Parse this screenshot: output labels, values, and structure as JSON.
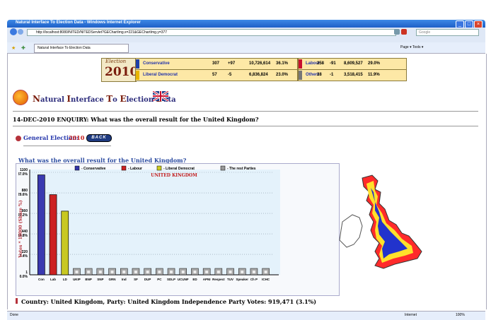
{
  "browser": {
    "window_title": "Natural Interface To Election Data - Windows Internet Explorer",
    "address": "http://localhost:8080/NITED/NITEDServlet?GEChartImg.x=221&GEChartImg.y=377",
    "search_placeholder": "Google",
    "tab_label": "Natural Interface To Election Data",
    "command_bar": "Page ▾  Tools ▾",
    "status_left": "Done",
    "status_zone": "Internet",
    "status_zoom": "100%"
  },
  "results": {
    "logo_top": "Election",
    "logo_year": "2010",
    "rows": [
      {
        "party": "Conservative",
        "seats": "307",
        "change": "+97",
        "votes": "10,726,614",
        "share": "36.1%",
        "color": "#1f3fa8"
      },
      {
        "party": "Liberal Democrat",
        "seats": "57",
        "change": "-5",
        "votes": "6,836,824",
        "share": "23.0%",
        "color": "#e8b500"
      },
      {
        "party": "Labour",
        "seats": "258",
        "change": "-91",
        "votes": "8,609,527",
        "share": "29.0%",
        "color": "#c8102e"
      },
      {
        "party": "Others",
        "seats": "28",
        "change": "-1",
        "votes": "3,518,415",
        "share": "11.9%",
        "color": "#777777"
      }
    ]
  },
  "header": {
    "title_parts": [
      "N",
      "atural ",
      "I",
      "nterface ",
      "T",
      "o ",
      "E",
      "lection ",
      "D",
      "ata"
    ]
  },
  "enquiry": "14-DEC-2010   ENQUIRY: What was the overall result for the United Kingdom?",
  "general_election": {
    "label": "General Election:",
    "year": "2010",
    "back": "BACK"
  },
  "chart_question": "What was the overall result for the United Kingdom?",
  "chart_data": {
    "type": "bar",
    "title": "UNITED KINGDOM",
    "ylabel": "Votes * 10000 (Share %)",
    "yticks": [
      {
        "value": 1,
        "label": "0.0%"
      },
      {
        "value": 220,
        "label": "7.4%"
      },
      {
        "value": 440,
        "label": "14.8%"
      },
      {
        "value": 660,
        "label": "22.2%"
      },
      {
        "value": 880,
        "label": "29.6%"
      },
      {
        "value": 1100,
        "label": "37.0%"
      }
    ],
    "ytick_numbers": [
      "1",
      "220",
      "440",
      "660",
      "880",
      "1100"
    ],
    "ylim": [
      1,
      1100
    ],
    "legend": [
      {
        "label": "- Conservative",
        "color": "#3333aa"
      },
      {
        "label": "- Labour",
        "color": "#cc2222"
      },
      {
        "label": "- Liberal Democrat",
        "color": "#cccc22"
      },
      {
        "label": "- The rest Parties",
        "color": "#999999"
      }
    ],
    "categories": [
      "Con",
      "Lab",
      "LD",
      "UKIP",
      "BNP",
      "SNP",
      "GRN",
      "Ind",
      "SF",
      "DUP",
      "PC",
      "SDLP",
      "UCUNF",
      "ED",
      "APNI",
      "Respect",
      "TUV",
      "Speaker",
      "Ch P",
      "ICHC"
    ],
    "values": [
      1073,
      861,
      684,
      0,
      0,
      0,
      0,
      0,
      0,
      0,
      0,
      0,
      0,
      0,
      0,
      0,
      0,
      0,
      0,
      0
    ],
    "colors": [
      "#3a3ab0",
      "#cc2222",
      "#c8c822",
      "#aaaaaa",
      "#aaaaaa",
      "#aaaaaa",
      "#aaaaaa",
      "#aaaaaa",
      "#aaaaaa",
      "#aaaaaa",
      "#aaaaaa",
      "#aaaaaa",
      "#aaaaaa",
      "#aaaaaa",
      "#aaaaaa",
      "#aaaaaa",
      "#aaaaaa",
      "#aaaaaa",
      "#aaaaaa",
      "#aaaaaa"
    ],
    "grid": true
  },
  "footer": "Country: United Kingdom, Party: United Kingdom Independence Party  Votes: 919,471 (3.1%)"
}
